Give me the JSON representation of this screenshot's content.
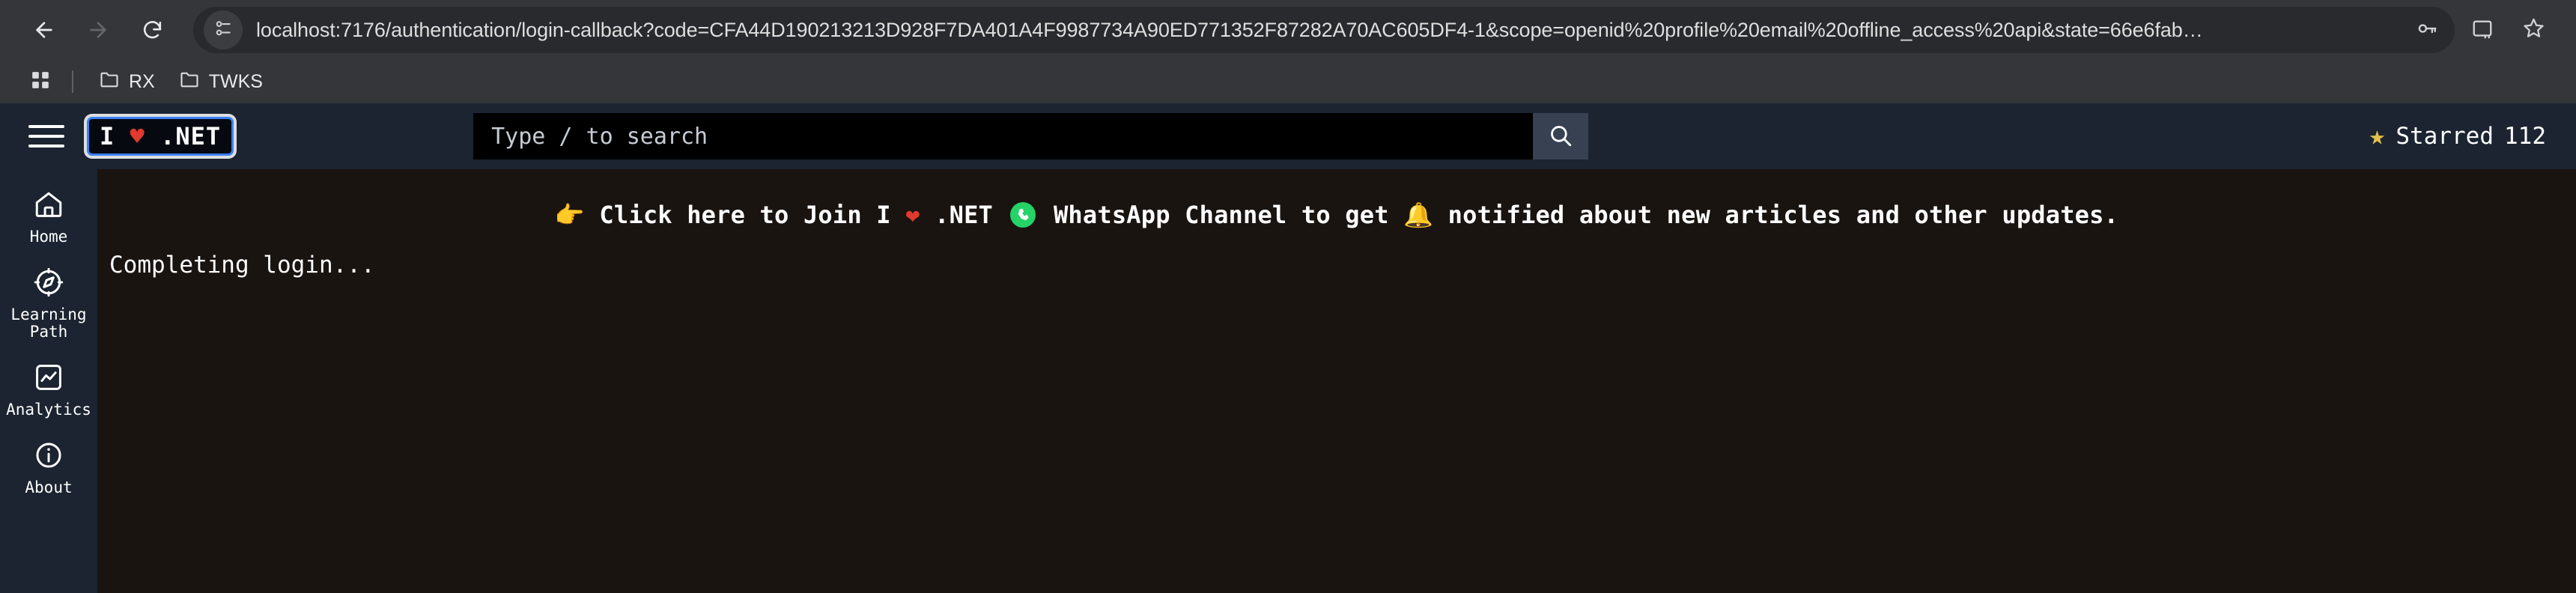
{
  "browser": {
    "back_icon": "back-arrow-icon",
    "forward_icon": "forward-arrow-icon",
    "reload_icon": "reload-icon",
    "site_info_icon": "site-settings-icon",
    "url": "localhost:7176/authentication/login-callback?code=CFA44D190213213D928F7DA401A4F9987734A90ED771352F87282A70AC605DF4-1&scope=openid%20profile%20email%20offline_access%20api&state=66e6fab…",
    "password_key_icon": "password-key-icon",
    "install_icon": "install-app-icon",
    "bookmark_star_icon": "bookmark-star-icon",
    "bookmarks": {
      "apps_icon": "apps-grid-icon",
      "items": [
        {
          "label": "RX",
          "icon": "folder-icon"
        },
        {
          "label": "TWKS",
          "icon": "folder-icon"
        }
      ]
    }
  },
  "app": {
    "menu_icon": "hamburger-menu-icon",
    "brand": {
      "prefix": "I",
      "heart": "♥",
      "suffix": ".NET"
    },
    "search": {
      "placeholder": "Type / to search",
      "value": "",
      "button_icon": "search-icon"
    },
    "starred": {
      "icon": "star-icon",
      "label": "Starred",
      "count": "112"
    },
    "sidebar": {
      "items": [
        {
          "label": "Home",
          "icon": "home-icon"
        },
        {
          "label": "Learning\nPath",
          "icon": "compass-icon"
        },
        {
          "label": "Analytics",
          "icon": "analytics-chart-icon"
        },
        {
          "label": "About",
          "icon": "info-circle-icon"
        }
      ]
    },
    "promo": {
      "pointer": "👉",
      "text_before_heart": "Click here to Join I",
      "heart": "❤",
      "text_after_heart": ".NET",
      "whatsapp_icon": "whatsapp-icon",
      "text_after_whatsapp": "WhatsApp Channel to get",
      "bell": "🔔",
      "text_end": "notified about new articles and other updates."
    },
    "status": "Completing login..."
  },
  "colors": {
    "browser_chrome": "#35363a",
    "omnibox": "#292a2d",
    "app_bg": "#1b2430",
    "content_bg": "#1a1411",
    "accent_blue": "#3b82f6",
    "heart_red": "#e0392e",
    "star_gold": "#e3c04a",
    "whatsapp_green": "#25d366"
  }
}
